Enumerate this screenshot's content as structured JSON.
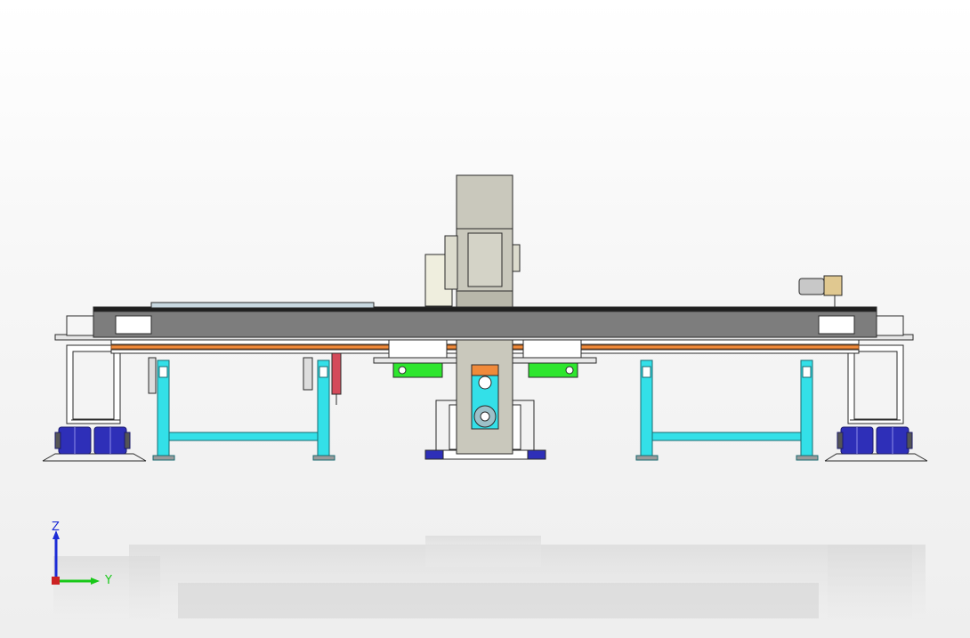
{
  "viewport": {
    "view": "front",
    "background": [
      "#ffffff",
      "#eeeeee"
    ],
    "colors": {
      "frame_cyan": "#33e0e8",
      "beam_gray": "#7d7d7d",
      "column_gray": "#c9c8bc",
      "motor_blue": "#2e2fb8",
      "bracket_green": "#2ee62e",
      "accent_orange": "#f08a3a",
      "cable_red": "#d44a5a",
      "edge": "#2a2a2a"
    }
  },
  "triad": {
    "z_label": "Z",
    "y_label": "Y",
    "z_color": "#1c2cd6",
    "y_color": "#18c818",
    "origin_color": "#cc2222"
  }
}
